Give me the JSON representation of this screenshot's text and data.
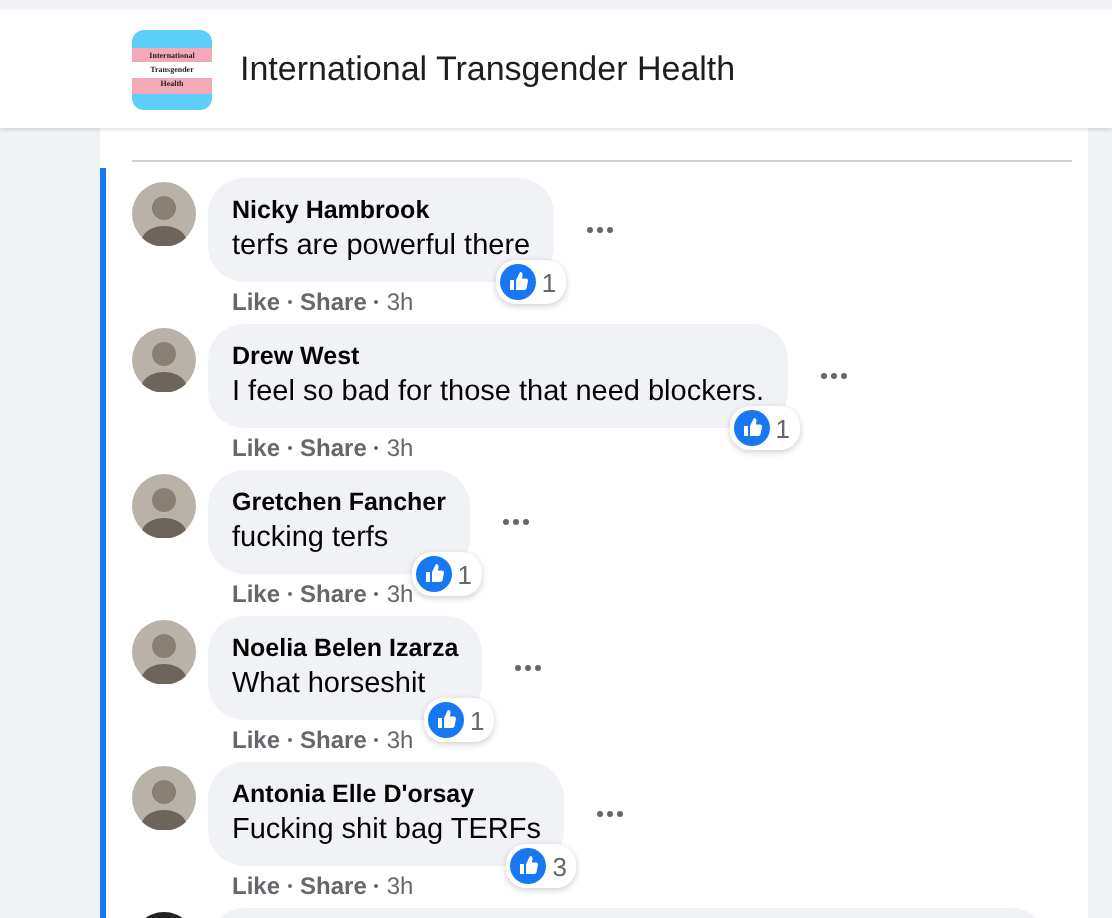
{
  "header": {
    "logo_lines": [
      "International",
      "Transgender",
      "Health"
    ],
    "title": "International Transgender Health"
  },
  "comments": [
    {
      "author": "Nicky Hambrook",
      "text": "terfs are powerful there",
      "reactions": "1",
      "actions": [
        {
          "label": "Like"
        },
        {
          "label": "Share"
        }
      ],
      "time": "3h"
    },
    {
      "author": "Drew West",
      "text": "I feel so bad for those that need blockers.",
      "reactions": "1",
      "actions": [
        {
          "label": "Like"
        },
        {
          "label": "Share"
        }
      ],
      "time": "3h"
    },
    {
      "author": "Gretchen Fancher",
      "text": "fucking terfs",
      "reactions": "1",
      "actions": [
        {
          "label": "Like"
        },
        {
          "label": "Share"
        }
      ],
      "time": "3h"
    },
    {
      "author": "Noelia Belen Izarza",
      "text": "What horseshit",
      "reactions": "1",
      "actions": [
        {
          "label": "Like"
        },
        {
          "label": "Share"
        }
      ],
      "time": "3h"
    },
    {
      "author": "Antonia Elle D'orsay",
      "text": "Fucking shit bag TERFs",
      "reactions": "3",
      "actions": [
        {
          "label": "Like"
        },
        {
          "label": "Share"
        }
      ],
      "time": "3h"
    }
  ]
}
